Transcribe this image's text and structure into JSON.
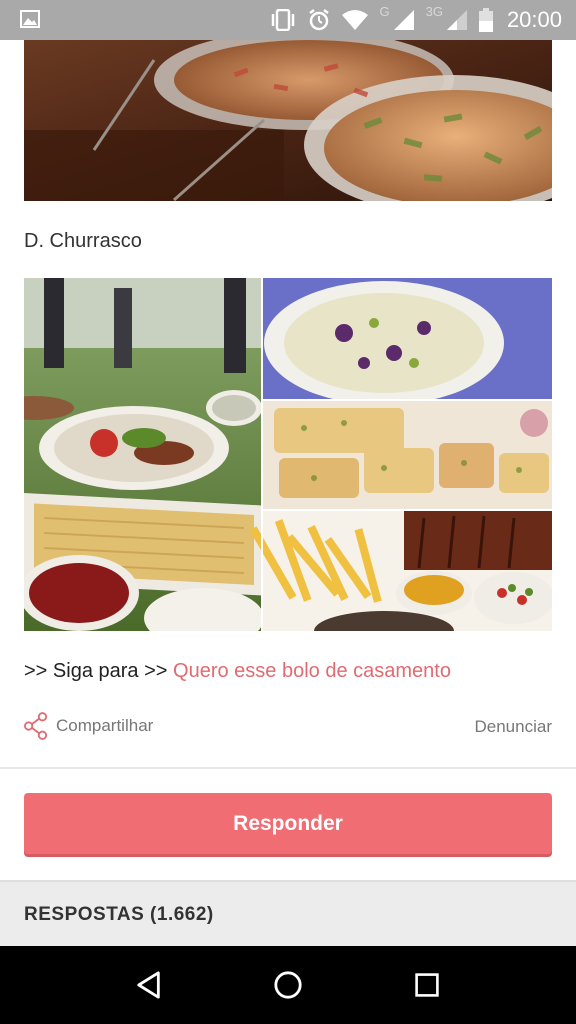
{
  "status_bar": {
    "time": "20:00",
    "network_label_1": "G",
    "network_label_2": "3G",
    "icons": [
      "image-icon",
      "vibrate-icon",
      "alarm-icon",
      "wifi-icon",
      "signal-icon",
      "signal-icon",
      "battery-icon"
    ]
  },
  "post": {
    "section_title": "D. Churrasco",
    "follow_prefix": ">> Siga para >> ",
    "follow_link": "Quero esse bolo de casamento",
    "share_label": "Compartilhar",
    "report_label": "Denunciar"
  },
  "reply_button_label": "Responder",
  "replies_header": "RESPOSTAS (1.662)",
  "colors": {
    "accent": "#f06d74",
    "link": "#e06b72",
    "status_bar": "#a9a9a9",
    "nav_bar": "#000000"
  }
}
